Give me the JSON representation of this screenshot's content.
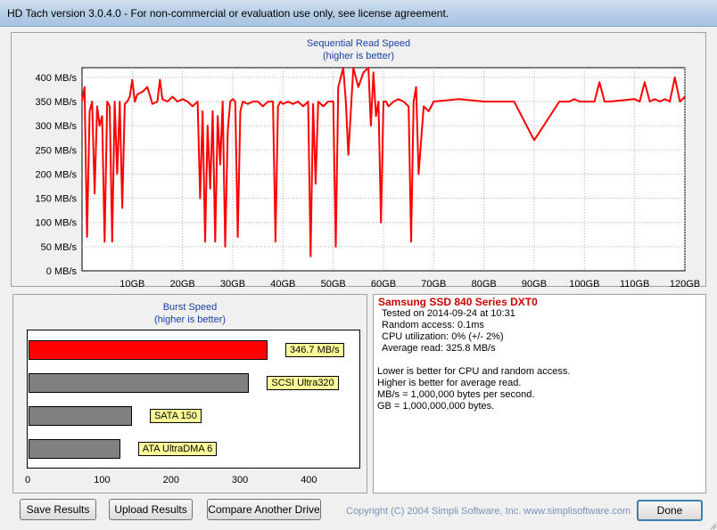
{
  "window": {
    "title": "HD Tach version 3.0.4.0  - For non-commercial or evaluation use only, see license agreement."
  },
  "read_chart": {
    "title": "Sequential Read Speed",
    "subtitle": "(higher is better)"
  },
  "burst_chart": {
    "title": "Burst Speed",
    "subtitle": "(higher is better)"
  },
  "chart_data": [
    {
      "type": "line",
      "title": "Sequential Read Speed",
      "subtitle": "(higher is better)",
      "y_unit": "MB/s",
      "ylim": [
        0,
        420
      ],
      "xlim": [
        0,
        120
      ],
      "x_ticks": [
        "10GB",
        "20GB",
        "30GB",
        "40GB",
        "50GB",
        "60GB",
        "70GB",
        "80GB",
        "90GB",
        "100GB",
        "110GB",
        "120GB"
      ],
      "y_ticks": [
        "0 MB/s",
        "50 MB/s",
        "100 MB/s",
        "150 MB/s",
        "200 MB/s",
        "250 MB/s",
        "300 MB/s",
        "350 MB/s",
        "400 MB/s"
      ],
      "grid": true,
      "series_color": "#ff0000",
      "x": [
        0,
        0.5,
        1,
        1.5,
        2,
        2.5,
        3,
        3.5,
        4,
        4.5,
        5,
        5.5,
        6,
        6.5,
        7,
        7.5,
        8,
        8.5,
        9,
        9.5,
        10,
        10.5,
        11,
        12,
        13,
        14,
        15,
        15.5,
        16,
        17,
        18,
        19,
        20,
        21,
        22,
        23,
        23.5,
        24,
        24.5,
        25,
        25.5,
        26,
        26.5,
        27,
        27.5,
        28,
        28.5,
        29,
        29.5,
        30,
        30.5,
        31,
        31.5,
        32,
        33,
        34,
        35,
        36,
        37,
        38,
        38.5,
        39,
        39.5,
        40,
        41,
        42,
        43,
        44,
        45,
        45.5,
        46,
        46.5,
        47,
        48,
        49,
        50,
        50.5,
        51,
        52,
        52.5,
        53,
        54,
        55,
        56,
        57,
        57.5,
        58,
        58.5,
        59,
        59.5,
        60,
        60.5,
        61,
        62,
        63,
        64,
        65,
        65.5,
        66,
        66.5,
        67,
        68,
        69,
        70,
        75,
        80,
        85,
        85.5,
        86,
        90,
        95,
        96,
        97,
        98,
        99,
        100,
        101,
        102,
        103,
        104,
        105,
        110,
        111,
        112,
        113,
        114,
        115,
        116,
        117,
        118,
        119,
        120
      ],
      "y": [
        350,
        380,
        70,
        330,
        350,
        160,
        340,
        300,
        320,
        60,
        350,
        340,
        60,
        350,
        200,
        350,
        130,
        345,
        350,
        360,
        395,
        350,
        365,
        370,
        380,
        345,
        350,
        395,
        355,
        350,
        360,
        350,
        355,
        350,
        340,
        350,
        150,
        330,
        60,
        300,
        170,
        330,
        60,
        320,
        220,
        350,
        50,
        290,
        350,
        355,
        350,
        70,
        330,
        350,
        345,
        350,
        350,
        340,
        350,
        350,
        60,
        340,
        350,
        345,
        350,
        345,
        350,
        340,
        350,
        30,
        345,
        180,
        350,
        340,
        350,
        350,
        50,
        380,
        420,
        350,
        240,
        420,
        380,
        410,
        420,
        300,
        410,
        320,
        350,
        100,
        350,
        350,
        340,
        350,
        355,
        350,
        340,
        60,
        350,
        380,
        200,
        340,
        330,
        350,
        355,
        350,
        350,
        350,
        350,
        270,
        350,
        350,
        350,
        355,
        350,
        350,
        350,
        350,
        390,
        350,
        350,
        355,
        350,
        390,
        350,
        355,
        350,
        355,
        350,
        400,
        350,
        360,
        355
      ]
    },
    {
      "type": "bar",
      "title": "Burst Speed",
      "subtitle": "(higher is better)",
      "orientation": "horizontal",
      "categories": [
        "346.7 MB/s",
        "SCSI Ultra320",
        "SATA 150",
        "ATA UltraDMA 6"
      ],
      "values": [
        346.7,
        320,
        150,
        133
      ],
      "colors": [
        "#ff0000",
        "#808080",
        "#808080",
        "#808080"
      ],
      "xlim": [
        0,
        480
      ],
      "x_ticks": [
        "0",
        "100",
        "200",
        "300",
        "400"
      ]
    }
  ],
  "info": {
    "drive_name": "Samsung SSD 840 Series DXT0",
    "tested_on": "Tested on 2014-09-24 at 10:31",
    "random_access": "Random access: 0.1ms",
    "cpu_utilization": "CPU utilization: 0% (+/- 2%)",
    "average_read": "Average read: 325.8 MB/s",
    "note1": "Lower is better for CPU and random access.",
    "note2": "Higher is better for average read.",
    "note3": "MB/s = 1,000,000 bytes per second.",
    "note4": "GB = 1,000,000,000 bytes."
  },
  "buttons": {
    "save": "Save Results",
    "upload": "Upload Results",
    "compare": "Compare Another Drive",
    "done": "Done"
  },
  "copyright": "Copyright (C) 2004 Simpli Software, Inc. www.simplisoftware.com"
}
